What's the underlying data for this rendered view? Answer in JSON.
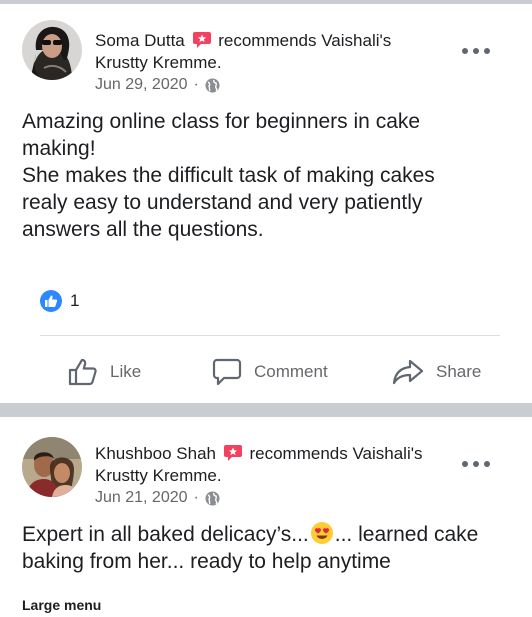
{
  "post1": {
    "author": "Soma Dutta",
    "recommends_text": "recommends",
    "page_name_a": "Vaishali's",
    "page_name_b": "Krustty Kremme",
    "period": ".",
    "date": "Jun 29, 2020",
    "separator": "·",
    "body_lines": [
      "Amazing online class for beginners in cake",
      "making!",
      "She makes the difficult task of making cakes",
      "realy easy to understand and very patiently",
      "answers all the questions."
    ],
    "reaction_count": "1",
    "actions": {
      "like": "Like",
      "comment": "Comment",
      "share": "Share"
    }
  },
  "post2": {
    "author": "Khushboo Shah",
    "recommends_text": "recommends",
    "page_name_a": "Vaishali's",
    "page_name_b": "Krustty Kremme",
    "period": ".",
    "date": "Jun 21, 2020",
    "separator": "·",
    "body_part1": "Expert in all baked delicacy’s...",
    "body_part2": "... learned cake",
    "body_line2": "baking from her... ready to help anytime",
    "footer_label": "Large menu"
  },
  "colors": {
    "like_blue": "#2d88ff",
    "separator_gray": "#c9ccd1",
    "meta_gray": "#65676b",
    "recommend_red": "#f3425f"
  }
}
